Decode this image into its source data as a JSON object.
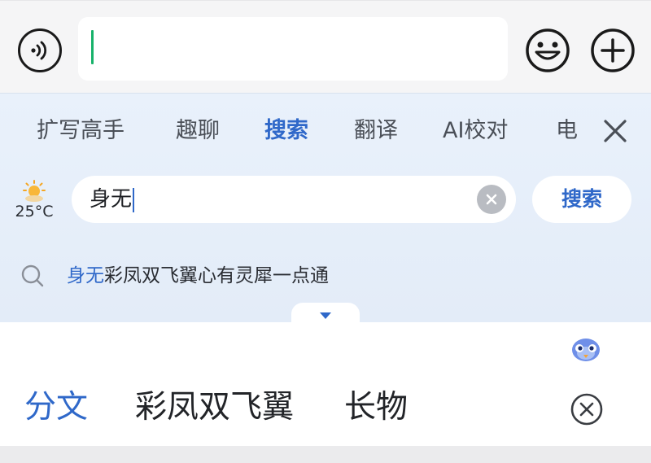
{
  "composer": {
    "voice_icon": "voice-icon",
    "emoji_icon": "smiley-icon",
    "plus_icon": "plus-icon",
    "message_value": ""
  },
  "assistant": {
    "tabs": [
      {
        "label": "扩写高手",
        "active": false
      },
      {
        "label": "趣聊",
        "active": false
      },
      {
        "label": "搜索",
        "active": true
      },
      {
        "label": "翻译",
        "active": false
      },
      {
        "label": "AI校对",
        "active": false
      },
      {
        "label": "电",
        "active": false
      }
    ],
    "close_icon": "close-icon",
    "weather": {
      "icon": "sun-cloud-icon",
      "temperature": "25°C"
    },
    "search": {
      "value": "身无",
      "clear_icon": "clear-icon",
      "button_label": "搜索"
    },
    "suggestion": {
      "highlight": "身无",
      "rest": "彩凤双飞翼心有灵犀一点通",
      "icon": "search-icon"
    }
  },
  "candidates": {
    "expand_icon": "chevron-down-icon",
    "mascot_icon": "mascot-icon",
    "items": [
      {
        "label": "分文",
        "active": true
      },
      {
        "label": "彩凤双飞翼",
        "active": false
      },
      {
        "label": "长物",
        "active": false
      }
    ],
    "close_icon": "circle-close-icon"
  },
  "colors": {
    "accent": "#2f68c9",
    "caret_green": "#17b26a",
    "panel_bg": "#e6eef9"
  }
}
